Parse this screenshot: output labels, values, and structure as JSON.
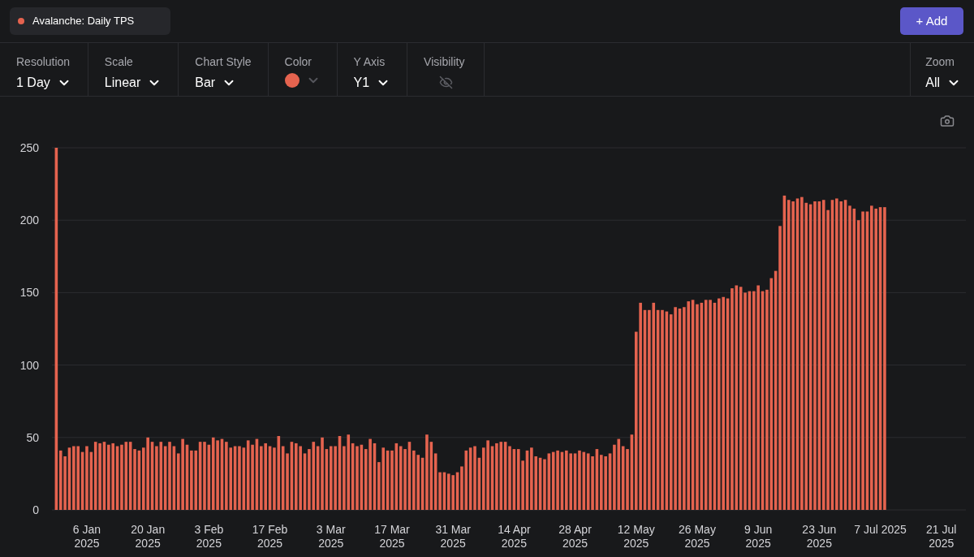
{
  "header": {
    "add_button": "+ Add"
  },
  "controls": [
    {
      "kind": "dropdown",
      "label": "Resolution",
      "value": "1 Day"
    },
    {
      "kind": "dropdown",
      "label": "Scale",
      "value": "Linear"
    },
    {
      "kind": "dropdown",
      "label": "Chart Style",
      "value": "Bar"
    },
    {
      "kind": "color",
      "label": "Color",
      "color": "#e5634f"
    },
    {
      "kind": "dropdown",
      "label": "Y Axis",
      "value": "Y1"
    },
    {
      "kind": "visibility",
      "label": "Visibility",
      "visible": false
    }
  ],
  "zoom": {
    "label": "Zoom",
    "value": "All"
  },
  "chart": {
    "chart_data": {
      "type": "bar",
      "categories": [
        null,
        null,
        null,
        null,
        null,
        null,
        null,
        "6 Jan\n2025",
        null,
        null,
        null,
        null,
        null,
        null,
        null,
        null,
        null,
        null,
        null,
        null,
        null,
        "20 Jan\n2025",
        null,
        null,
        null,
        null,
        null,
        null,
        null,
        null,
        null,
        null,
        null,
        null,
        null,
        "3 Feb\n2025",
        null,
        null,
        null,
        null,
        null,
        null,
        null,
        null,
        null,
        null,
        null,
        null,
        null,
        "17 Feb\n2025",
        null,
        null,
        null,
        null,
        null,
        null,
        null,
        null,
        null,
        null,
        null,
        null,
        null,
        "3 Mar\n2025",
        null,
        null,
        null,
        null,
        null,
        null,
        null,
        null,
        null,
        null,
        null,
        null,
        null,
        "17 Mar\n2025",
        null,
        null,
        null,
        null,
        null,
        null,
        null,
        null,
        null,
        null,
        null,
        null,
        null,
        "31 Mar\n2025",
        null,
        null,
        null,
        null,
        null,
        null,
        null,
        null,
        null,
        null,
        null,
        null,
        null,
        "14 Apr\n2025",
        null,
        null,
        null,
        null,
        null,
        null,
        null,
        null,
        null,
        null,
        null,
        null,
        null,
        "28 Apr\n2025",
        null,
        null,
        null,
        null,
        null,
        null,
        null,
        null,
        null,
        null,
        null,
        null,
        null,
        "12 May\n2025",
        null,
        null,
        null,
        null,
        null,
        null,
        null,
        null,
        null,
        null,
        null,
        null,
        null,
        "26 May\n2025",
        null,
        null,
        null,
        null,
        null,
        null,
        null,
        null,
        null,
        null,
        null,
        null,
        null,
        "9 Jun\n2025",
        null,
        null,
        null,
        null,
        null,
        null,
        null,
        null,
        null,
        null,
        null,
        null,
        null,
        "23 Jun\n2025",
        null,
        null,
        null,
        null,
        null,
        null,
        null,
        null,
        null,
        null,
        null,
        null,
        null,
        "7 Jul 2025",
        null,
        null,
        null,
        null,
        null,
        null,
        null,
        null,
        null,
        null,
        null,
        null,
        null,
        "21 Jul\n2025",
        null,
        null,
        null,
        null,
        null
      ],
      "series": [
        {
          "name": "Avalanche: Daily TPS",
          "color": "#e5634f",
          "values": [
            250,
            41,
            37,
            43,
            44,
            44,
            40,
            44,
            40,
            47,
            46,
            47,
            45,
            46,
            44,
            45,
            47,
            47,
            42,
            41,
            43,
            50,
            47,
            44,
            47,
            44,
            47,
            44,
            39,
            49,
            45,
            41,
            41,
            47,
            47,
            45,
            50,
            48,
            49,
            47,
            43,
            44,
            44,
            43,
            48,
            45,
            49,
            44,
            46,
            44,
            43,
            51,
            44,
            39,
            47,
            46,
            44,
            39,
            42,
            47,
            44,
            50,
            42,
            44,
            44,
            51,
            44,
            52,
            46,
            44,
            45,
            42,
            49,
            46,
            33,
            43,
            41,
            41,
            46,
            44,
            42,
            47,
            41,
            38,
            36,
            52,
            47,
            39,
            26,
            26,
            25,
            24,
            26,
            30,
            41,
            43,
            44,
            36,
            43,
            48,
            44,
            46,
            47,
            47,
            44,
            42,
            42,
            34,
            41,
            43,
            37,
            36,
            35,
            39,
            40,
            41,
            40,
            41,
            39,
            39,
            41,
            40,
            39,
            37,
            42,
            38,
            37,
            39,
            45,
            49,
            44,
            42,
            52,
            123,
            143,
            138,
            138,
            143,
            138,
            138,
            137,
            135,
            140,
            139,
            140,
            144,
            145,
            142,
            143,
            145,
            145,
            143,
            146,
            147,
            146,
            153,
            155,
            154,
            150,
            151,
            151,
            155,
            151,
            152,
            160,
            165,
            196,
            217,
            214,
            213,
            215,
            216,
            212,
            211,
            213,
            213,
            214,
            207,
            214,
            215,
            213,
            214,
            210,
            208,
            200,
            206,
            206,
            210,
            208,
            209,
            209,
            null,
            null,
            null,
            null,
            null,
            null,
            null,
            null,
            null,
            null,
            null,
            null,
            null,
            null,
            null,
            null,
            null,
            null
          ]
        }
      ],
      "grid": true,
      "ylim": [
        0,
        250
      ],
      "yticks": [
        0,
        50,
        100,
        150,
        200,
        250
      ]
    }
  }
}
